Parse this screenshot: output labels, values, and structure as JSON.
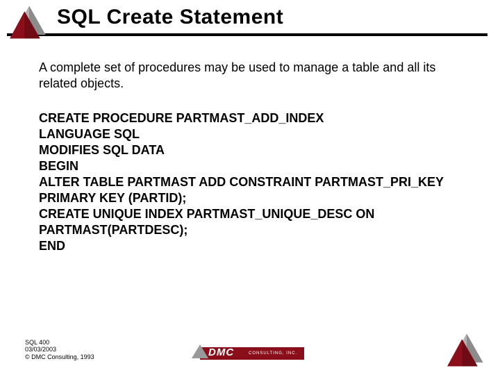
{
  "title": "SQL Create Statement",
  "intro": "A complete set of procedures may be used to manage a table and all its related objects.",
  "code": "CREATE PROCEDURE PARTMAST_ADD_INDEX\nLANGUAGE SQL\nMODIFIES SQL DATA\nBEGIN\nALTER TABLE PARTMAST ADD CONSTRAINT PARTMAST_PRI_KEY\nPRIMARY KEY (PARTID);\nCREATE UNIQUE INDEX PARTMAST_UNIQUE_DESC ON PARTMAST(PARTDESC);\nEND",
  "footer": {
    "line1": "SQL 400",
    "line2": "03/03/2003",
    "line3": "DMC Consulting, 1993"
  },
  "dmc": {
    "name": "DMC",
    "sub": "CONSULTING, INC."
  }
}
